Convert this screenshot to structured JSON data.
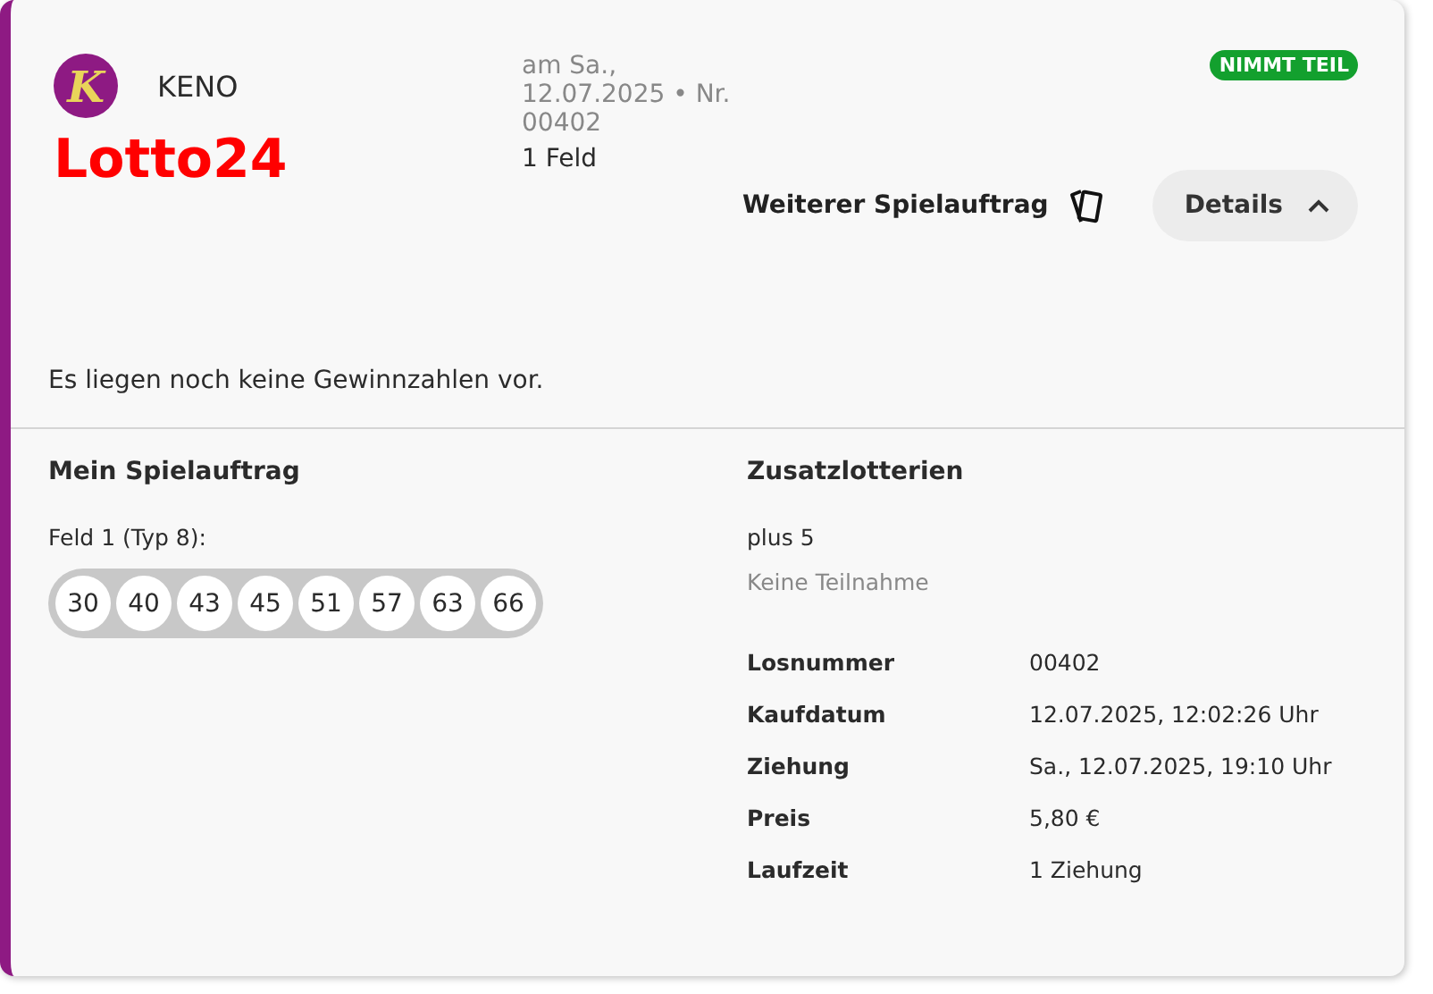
{
  "ticket": {
    "logo_letter": "K",
    "game": "KENO",
    "brand": "Lotto24",
    "draw_info": "am Sa., 12.07.2025 • Nr. 00402",
    "fields": "1 Feld",
    "status": {
      "label": "NIMMT TEIL",
      "color": "#13a02e"
    },
    "actions": {
      "another_order": "Weiterer Spielauftrag",
      "details": {
        "label": "Details",
        "expanded": true
      }
    },
    "message": "Es liegen noch keine Gewinnzahlen vor.",
    "my_order": {
      "heading": "Mein Spielauftrag",
      "field_label": "Feld 1 (Typ 8):",
      "numbers": [
        "30",
        "40",
        "43",
        "45",
        "51",
        "57",
        "63",
        "66"
      ]
    },
    "extra_lotteries": {
      "heading": "Zusatzlotterien",
      "name": "plus 5",
      "participation": "Keine Teilnahme"
    },
    "details": [
      {
        "label": "Losnummer",
        "value": "00402"
      },
      {
        "label": "Kaufdatum",
        "value": "12.07.2025, 12:02:26 Uhr"
      },
      {
        "label": "Ziehung",
        "value": "Sa., 12.07.2025, 19:10 Uhr"
      },
      {
        "label": "Preis",
        "value": "5,80 €"
      },
      {
        "label": "Laufzeit",
        "value": "1 Ziehung"
      }
    ]
  }
}
